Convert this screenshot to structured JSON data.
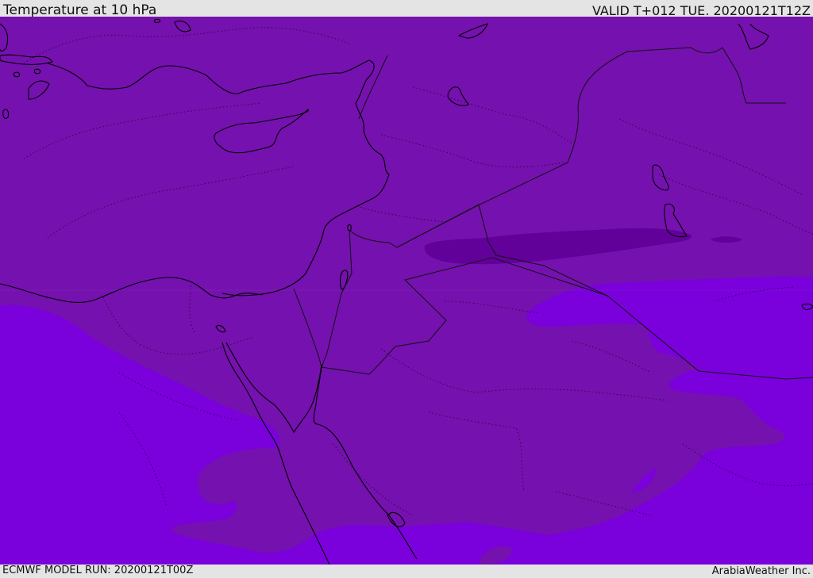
{
  "header": {
    "title": "Temperature at 10 hPa",
    "valid": "VALID T+012 TUE. 20200121T12Z"
  },
  "footer": {
    "model_run": "ECMWF MODEL RUN: 20200121T00Z",
    "brand": "ArabiaWeather Inc."
  },
  "colors": {
    "header_bg": "#e4e4e4",
    "band_coldest": "#62009a",
    "band_cold": "#7511ae",
    "band_warm": "#7a00dc",
    "coastline": "#000000",
    "borders": "#222222"
  }
}
